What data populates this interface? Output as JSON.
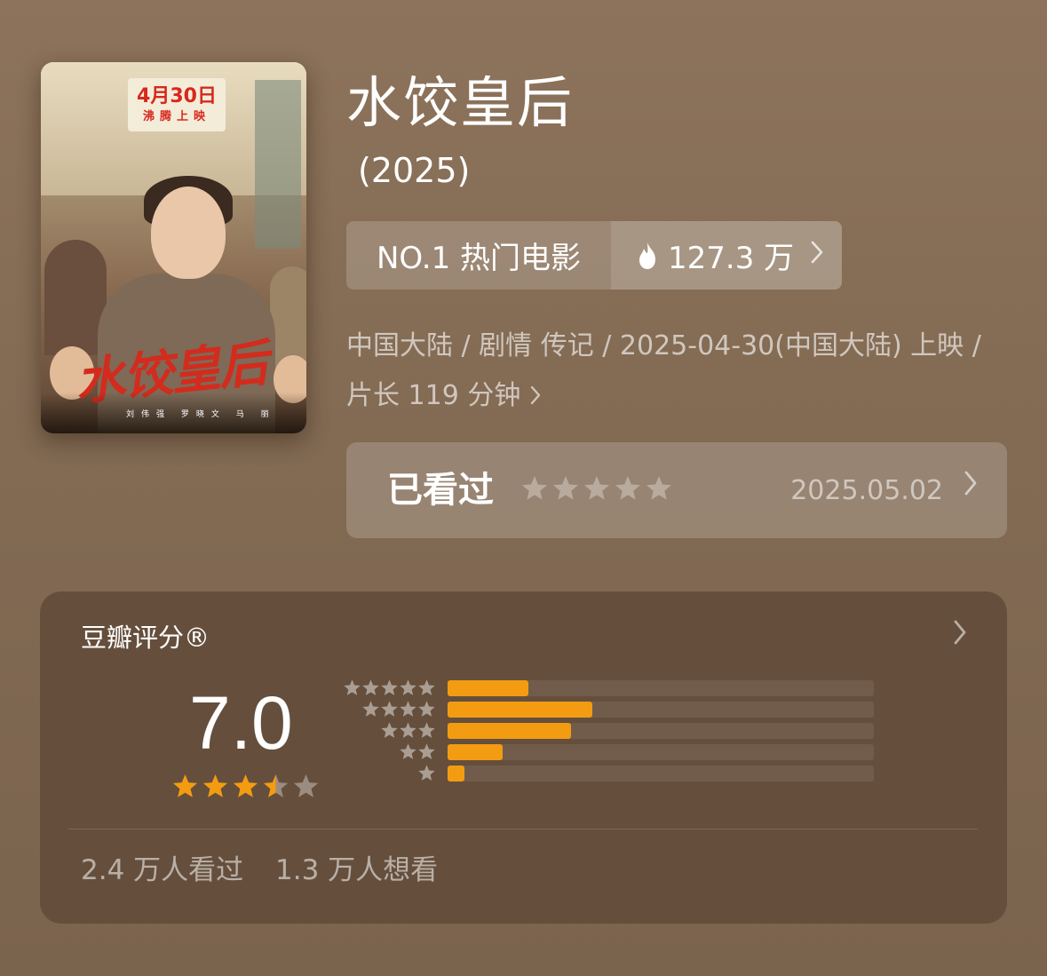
{
  "movie": {
    "title": "水饺皇后",
    "year": "(2025)",
    "poster": {
      "date_text": "4月30日",
      "release_text": "沸腾上映",
      "title_art": "水饺皇后",
      "credits": "刘伟强 罗晓文 马 丽"
    }
  },
  "rank": {
    "label": "NO.1 热门电影",
    "heat": "127.3 万",
    "flame_icon": "flame-icon",
    "chevron_icon": "chevron-right-icon"
  },
  "meta": {
    "line": "中国大陆 / 剧情 传记 / 2025-04-30(中国大陆) 上映 / 片长 119 分钟"
  },
  "watched": {
    "label": "已看过",
    "stars_filled": 0,
    "stars_total": 5,
    "date": "2025.05.02"
  },
  "rating": {
    "title": "豆瓣评分®",
    "score": "7.0",
    "score_stars": 3.5,
    "distribution": [
      {
        "stars": 5,
        "fraction": 0.19
      },
      {
        "stars": 4,
        "fraction": 0.34
      },
      {
        "stars": 3,
        "fraction": 0.29
      },
      {
        "stars": 2,
        "fraction": 0.13
      },
      {
        "stars": 1,
        "fraction": 0.04
      }
    ],
    "watched_count": "2.4 万人看过",
    "want_count": "1.3 万人想看"
  },
  "colors": {
    "accent": "#f39c12",
    "card": "#654f3c",
    "background": "#8d735b"
  }
}
